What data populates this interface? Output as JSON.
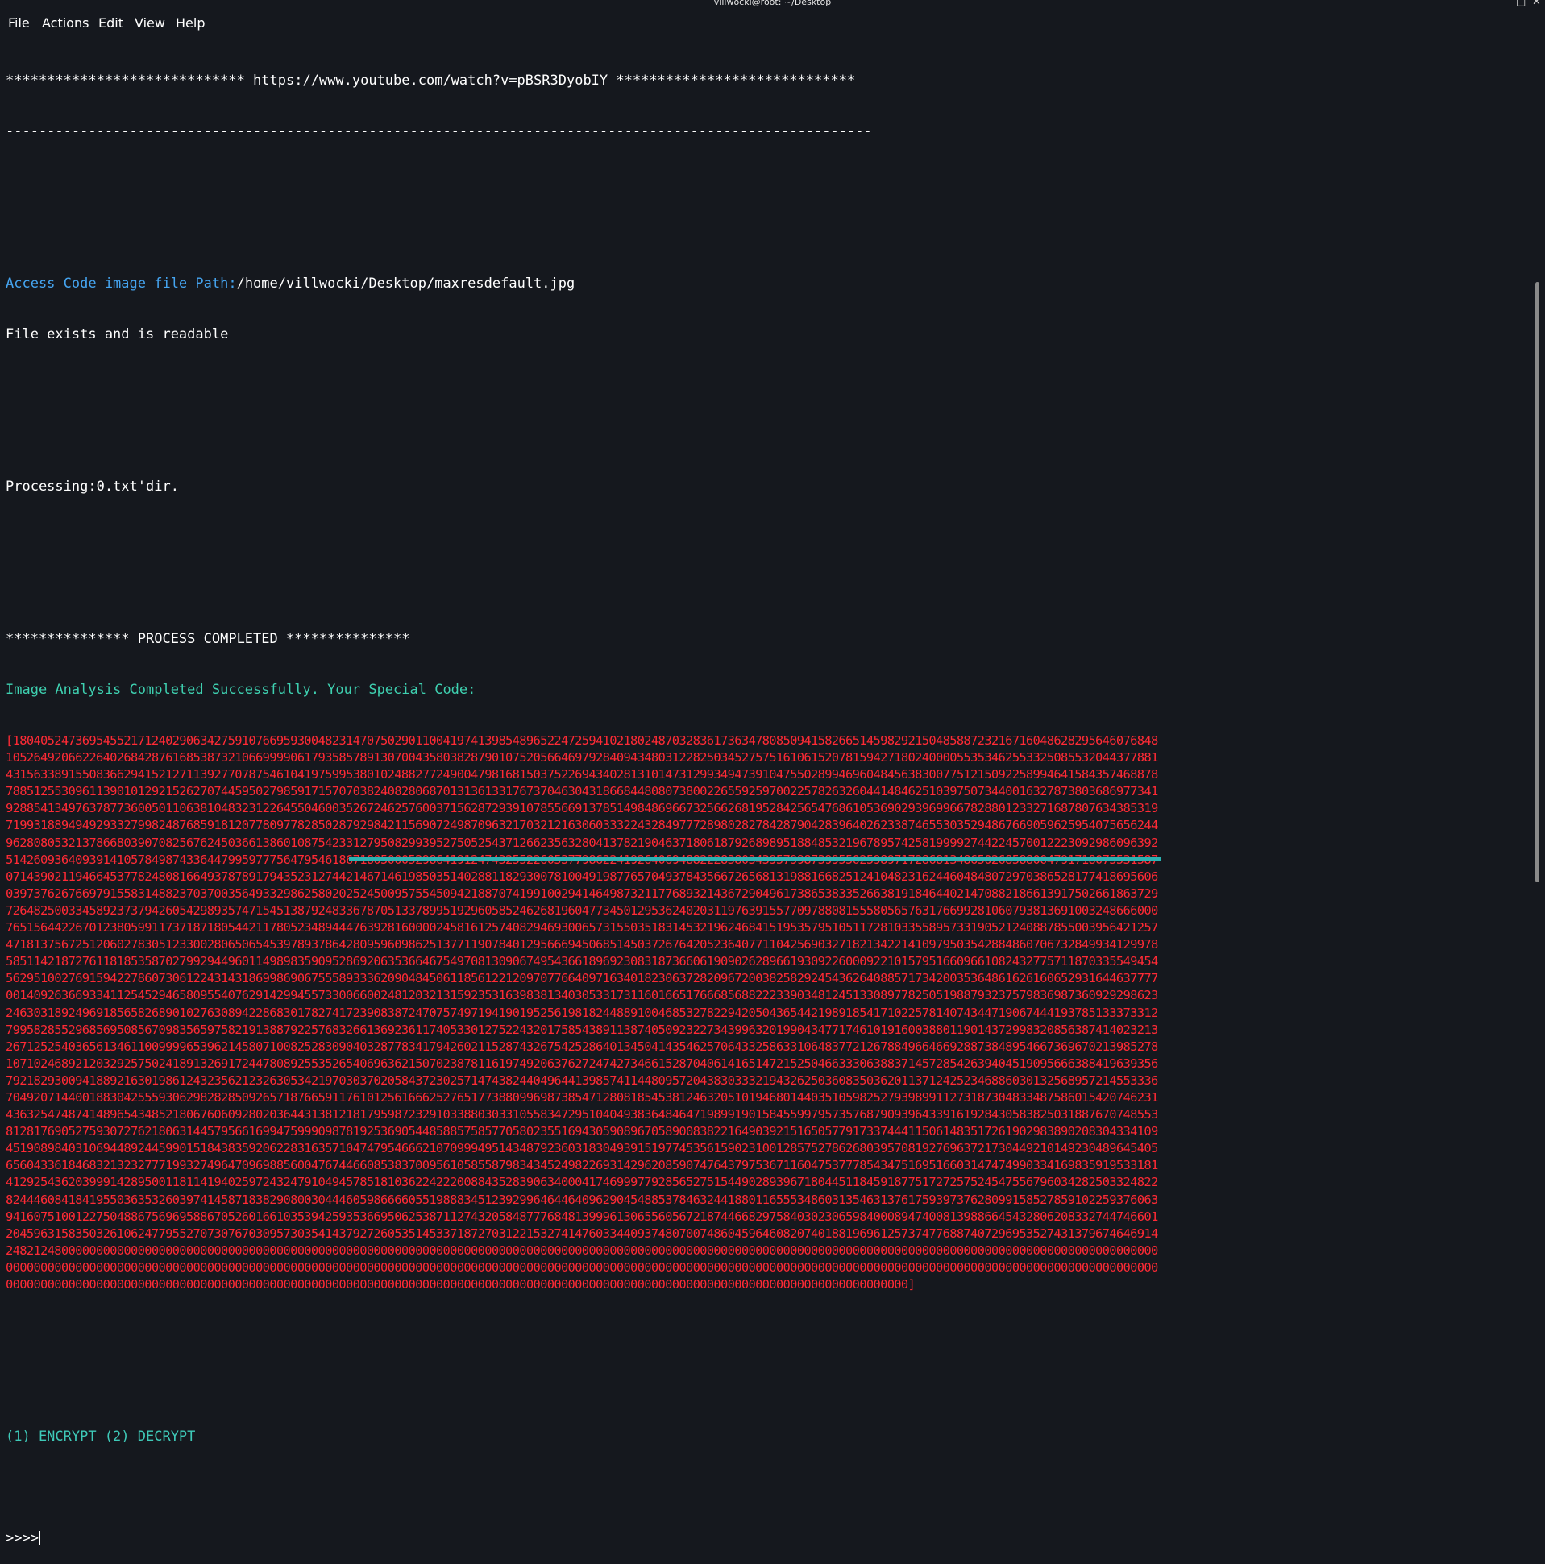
{
  "window": {
    "title": "villwocki@root: ~/Desktop",
    "controls": [
      "–",
      "□",
      "✕"
    ]
  },
  "menu": [
    "File",
    "Actions",
    "Edit",
    "View",
    "Help"
  ],
  "terminal": {
    "url_line": "***************************** https://www.youtube.com/watch?v=pBSR3DyobIY *****************************",
    "dash_line": "---------------------------------------------------------------------------------------------------------",
    "path_label": "Access Code image file Path:",
    "path_value": "/home/villwocki/Desktop/maxresdefault.jpg",
    "file_status": "File exists and is readable",
    "processing": "Processing:0.txt'dir.",
    "completed": "*************** PROCESS COMPLETED ***************",
    "analysis": "Image Analysis Completed Successfully. Your Special Code:",
    "code_lines": [
      "[18040524736954552171240290634275910766959300482314707502901100419741398548965224725941021802487032836173634780850941582665145982921504858872321671604862829564607684810526492066226402684287616853873210669999061793585789130700435803828790107520566469792840943480312282503452757516106152078159427180240000553534625533250855320443778814315633891550836629415212711392770787546104197599538010248827724900479816815037522694340281310147312993494739104755028994696048456383007751215092258994641584357468878788512553096113901012921526270744595027985917157070382408280687013136133176737046304318668448080738002265592597002257826326044148462510397507344001632787380368697734192885413497637877360050110638104832312264550460035267246257600371562872939107855669137851498486966732566268195284256547686105369029396996678288012332716878076343853197199318894949293327998248768591812077809778285028792984211569072498709632170321216306033322432849777289802827842879042839640262338746553035294867669059625954075656244962808053213786680390708256762450366138601087542331279508299395275052543712662356328041378219046371806187926898951884853219678957425819999274422457001222309298609639251426093640939141057849874336447995977756479546186718050005298641912474325522605377986224192640694882228380343957998739955025989717286813486502685880047917180755315870714390211946645377824808166493787891794352312744214671461985035140288118293007810049198776570493784356672656813198816682512410482316244604848072970386528177418695606039737626766979155831488237037003564933298625802025245009575545094218870741991002941464987321177689321436729049617386538335266381918464402147088218661391750266186372972648250033458923737942605429893574715451387924833678705133789951929605852462681960477345012953624020311976391557709788081555805657631766992810607938136910032486660007651564422670123805991173718718054421178052348944476392816000024581612574082946930065731550351831453219624684151953579510511728103355895733190521240887855003956421257471813756725120602783051233002806506545397893786428095960986251377119078401295666945068514503726764205236407711042569032718213422141097950354288486070673284993412997858511421872761181853587027992944960114989835909528692063536646754970813090674954366189692308318736606190902628966193092260009221015795166096610824327757118703355494545629510027691594227860730612243143186998690675558933362090484506118561221209707766409716340182306372820967200382582924543626408857173420035364861626160652931644637777001409263669334112545294658095540762914299455733006600248120321315923531639838134030533173116016651766685688222339034812451330897782505198879323757983698736092929862324630318924969185658268901027630894228683017827417239083872470757497194190195256198182448891004685327822942050436544219891854171022578140743447190674441937851333733127995828552968569508567098356597582191388792257683266136923611740533012752243201758543891138740509232273439963201990434771746101916003880119014372998320856387414023213267125254036561346110099996539621458071008252830904032877834179426021152874326754252864013450414354625706433258633106483772126788496646692887384895466736967021398527810710246892120329257502418913269172447808925535265406963621507023878116197492063762724742734661528704061416514721525046633306388371457285426394045190956663884196393567921829300941889216301986124323562123263053421970303702058437230257147438244049644139857411448095720438303332194326250360835036201137124252346886030132568957214553336704920714400188304255593062982828509265718766591176101256166625276517738809969873854712808185453812463205101946801440351059825279398991127318730483348758601542074623143632547487414896543485218067606092802036443138121817959872329103388030331055834729510404938364846471989919015845599795735768790939643391619284305838250318876707485538128176905275930727621806314457956616994759990987819253690544858857585770580235516943059089670589008382216490392151650577917337444115061483517261902983890208304334109451908984031069448924459901518438359206228316357104747954666210709994951434879236031830493915197745356159023100128575278626803957081927696372173044921014923048964540565604336184683213232777199327496470969885600476744660853837009561058558798343452498226931429620859074764379753671160475377785434751695166031474749903341698359195331814129254362039991428950011811419402597243247910494578518103622422200884352839063400041746999779285652751544902893967180445118459187751727257524547556796034282503324822824446084184195503635326039741458718382908003044460598666605519888345123929964644640962904548853784632441880116555348603135463137617593973762809915852785910225937606394160751001227504886756969588670526016610353942593536695062538711274320584877768481399961306556056721874466829758403023065984000894740081398866454328062083327447466012045963158350326106247795527073076703095730354143792726053514533718727031221532741476033440937480700748604596460820740188196961257374776887407296953527431379674646914248212480000000000000000000000000000000000000000000000000000000000000000000000000000000000000000000000000000000000000000000000000000000000000000000000000000000000000000000000000000000000000000000000000000000000000000000000000000000000000000000000000000000000000000000000000000000000000000000000000000000000000000000000000000000000000000000000000000000000000000000000000000000000000000000000000000000000000000000000000000000000000000000000000000000000000000000000]"
    ],
    "options": "(1) ENCRYPT (2) DECRYPT",
    "prompt": ">>>>"
  }
}
